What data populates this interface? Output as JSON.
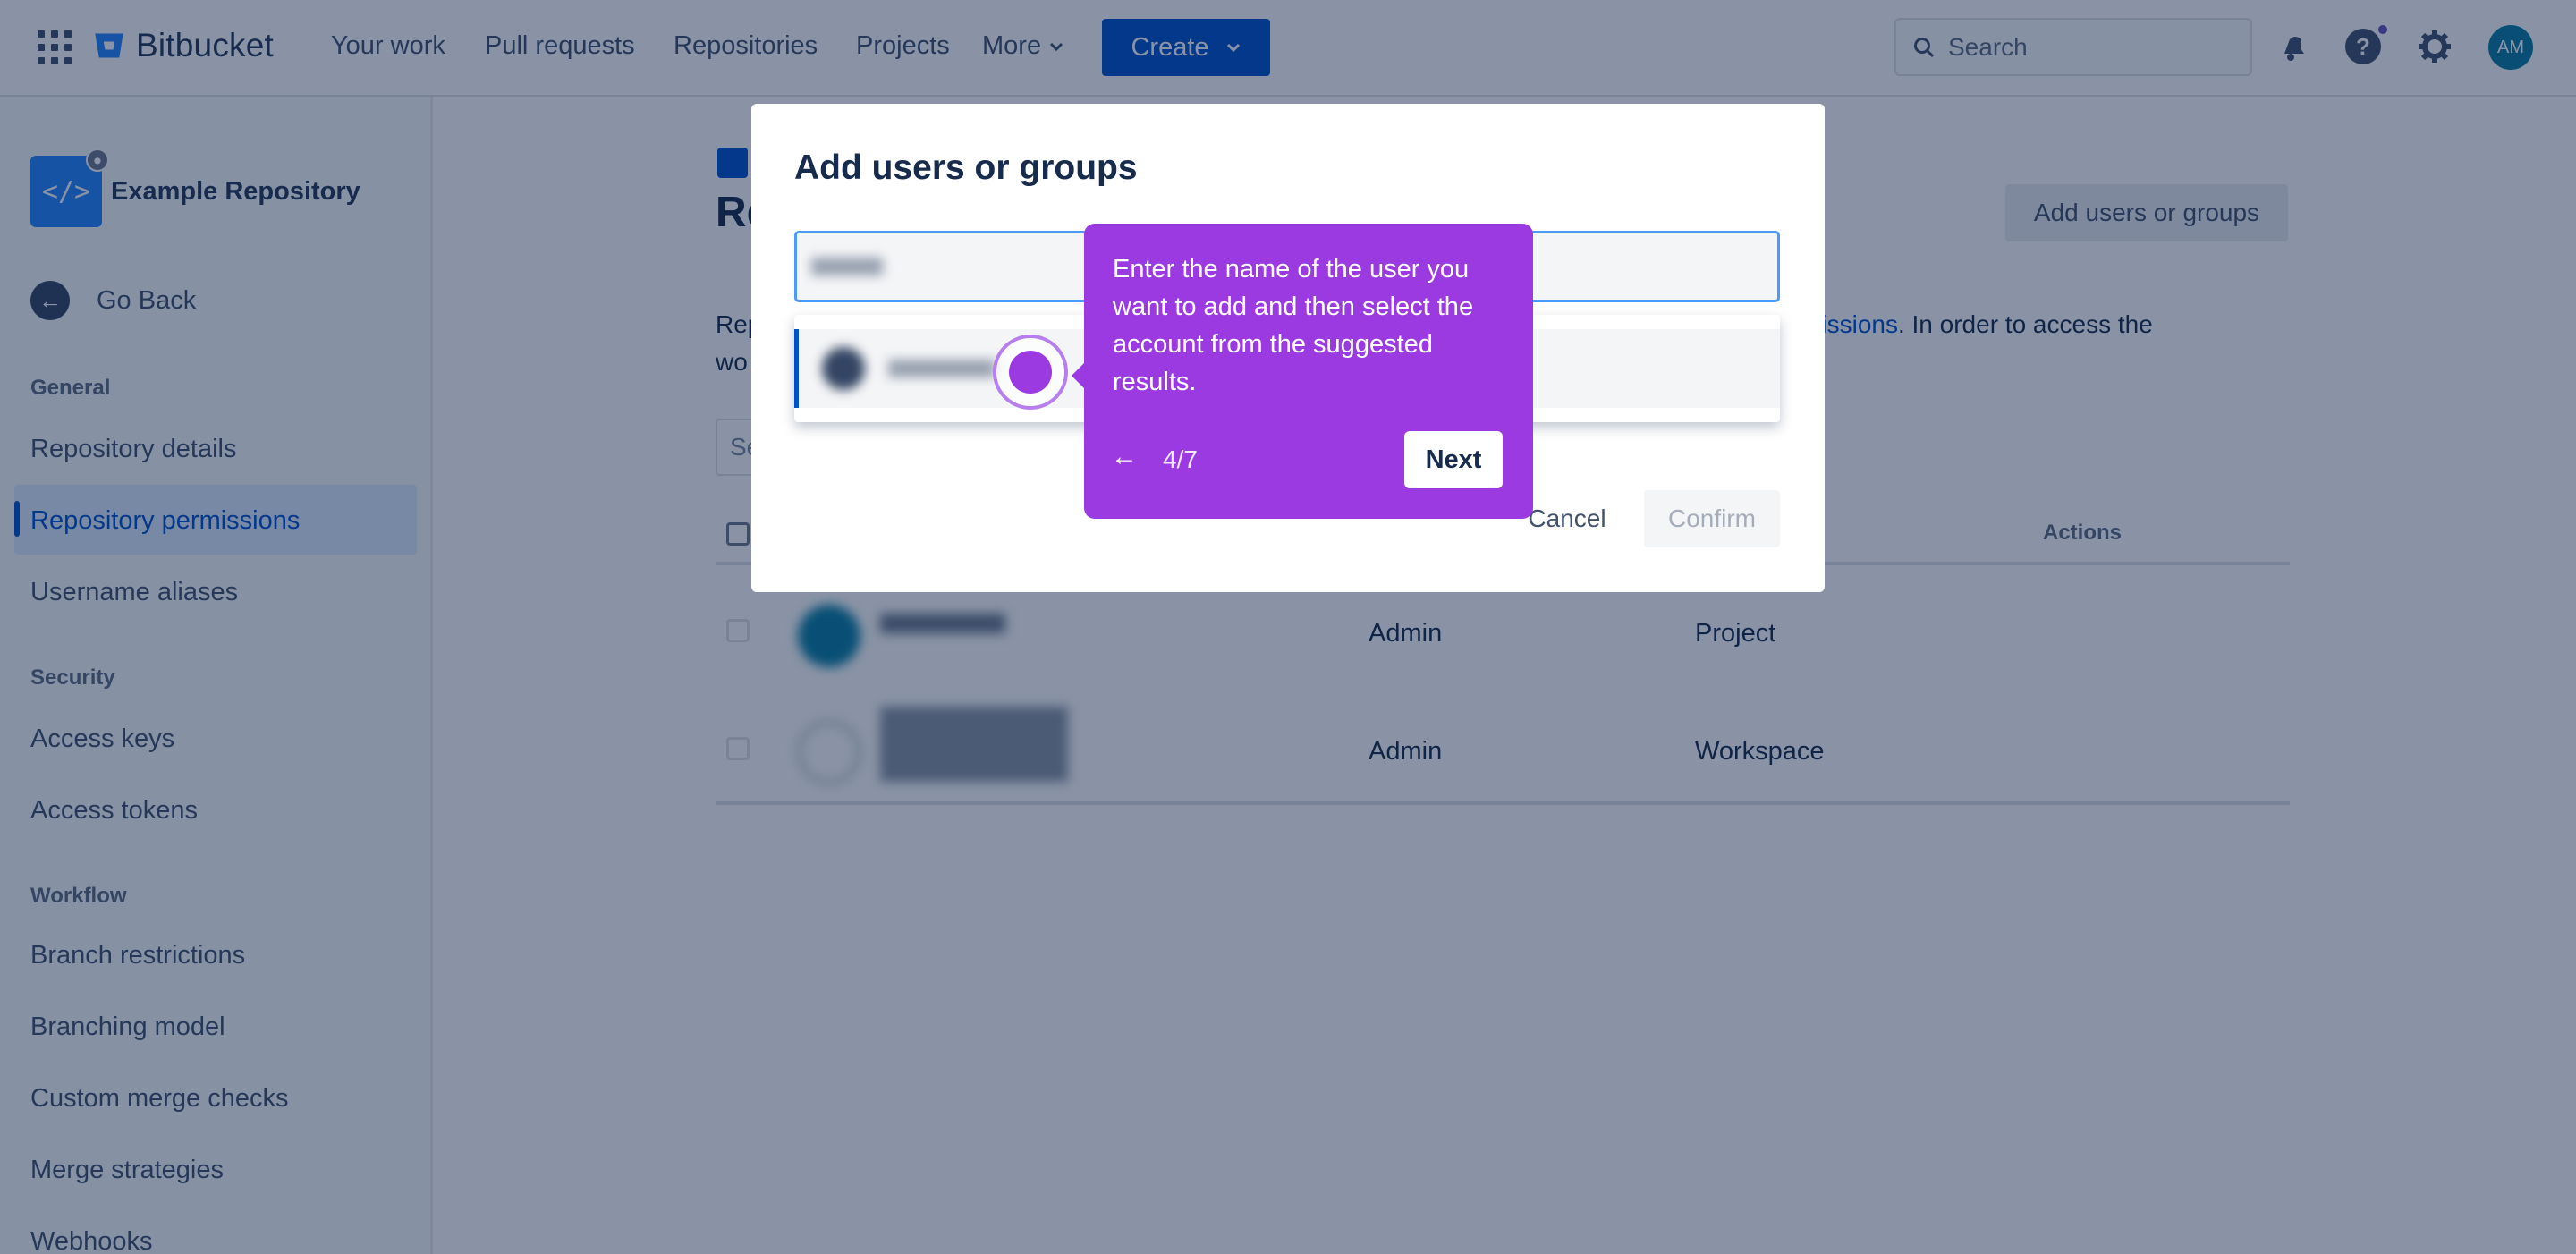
{
  "topnav": {
    "product": "Bitbucket",
    "items": [
      "Your work",
      "Pull requests",
      "Repositories",
      "Projects"
    ],
    "more_label": "More",
    "create_label": "Create",
    "search_placeholder": "Search",
    "avatar_initials": "AM"
  },
  "sidebar": {
    "repo_name": "Example Repository",
    "go_back": "Go Back",
    "sections": [
      {
        "heading": "General",
        "items": [
          "Repository details",
          "Repository permissions",
          "Username aliases"
        ]
      },
      {
        "heading": "Security",
        "items": [
          "Access keys",
          "Access tokens"
        ]
      },
      {
        "heading": "Workflow",
        "items": [
          "Branch restrictions",
          "Branching model",
          "Custom merge checks",
          "Merge strategies",
          "Webhooks"
        ]
      }
    ],
    "active_item": "Repository permissions"
  },
  "main": {
    "title_partial": "Re",
    "add_button": "Add users or groups",
    "desc_line1_start": "Rep",
    "desc_link": "issions",
    "desc_line1_end": ". In order to access the",
    "desc_line2_start": "wo",
    "filter_placeholder": "Se",
    "table": {
      "headers": {
        "actions": "Actions"
      },
      "rows": [
        {
          "role": "Admin",
          "source": "Project"
        },
        {
          "role": "Admin",
          "source": "Workspace"
        }
      ]
    }
  },
  "modal": {
    "title": "Add users or groups",
    "cancel_label": "Cancel",
    "confirm_label": "Confirm"
  },
  "tour": {
    "text": "Enter the name of the user you want to add and then select the account from the suggested results.",
    "step": "4/7",
    "next_label": "Next",
    "accent_color": "#9a3ae0"
  }
}
